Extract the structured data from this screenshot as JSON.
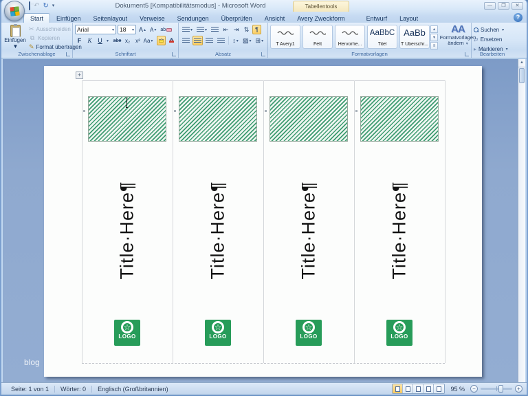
{
  "window": {
    "title": "Dokument5 [Kompatibilitätsmodus] - Microsoft Word",
    "contextual_tool_label": "Tabellentools",
    "help_label": "?"
  },
  "tabs": [
    {
      "label": "Start",
      "active": true
    },
    {
      "label": "Einfügen"
    },
    {
      "label": "Seitenlayout"
    },
    {
      "label": "Verweise"
    },
    {
      "label": "Sendungen"
    },
    {
      "label": "Überprüfen"
    },
    {
      "label": "Ansicht"
    },
    {
      "label": "Avery Zweckform"
    },
    {
      "label": "Entwurf",
      "contextual": true
    },
    {
      "label": "Layout",
      "contextual": true
    }
  ],
  "ribbon": {
    "clipboard": {
      "group_label": "Zwischenablage",
      "paste_label": "Einfügen",
      "cut_label": "Ausschneiden",
      "copy_label": "Kopieren",
      "format_painter_label": "Format übertragen"
    },
    "font": {
      "group_label": "Schriftart",
      "family": "Arial",
      "size": "18",
      "bold": "F",
      "italic": "K",
      "underline": "U",
      "strikethrough": "abe",
      "subscript": "x₂",
      "superscript": "x²",
      "change_case": "Aa"
    },
    "paragraph": {
      "group_label": "Absatz",
      "pilcrow": "¶"
    },
    "styles": {
      "group_label": "Formatvorlagen",
      "change_label": "Formatvorlagen ändern",
      "items": [
        {
          "label": "T Avery1",
          "preview": ""
        },
        {
          "label": "Fett",
          "preview": ""
        },
        {
          "label": "Hervorhe...",
          "preview": ""
        },
        {
          "label": "Titel",
          "preview": "AaBbC"
        },
        {
          "label": "T Überschr...",
          "preview": "AaBb"
        }
      ]
    },
    "editing": {
      "group_label": "Bearbeiten",
      "find_label": "Suchen",
      "replace_label": "Ersetzen",
      "select_label": "Markieren"
    }
  },
  "document": {
    "columns": [
      {
        "title": "Title·Here¶",
        "logo_text": "LOGO"
      },
      {
        "title": "Title·Here¶",
        "logo_text": "LOGO"
      },
      {
        "title": "Title·Here¶",
        "logo_text": "LOGO"
      },
      {
        "title": "Title·Here¶",
        "logo_text": "LOGO"
      }
    ]
  },
  "watermark": "blog",
  "status": {
    "page": "Seite: 1 von 1",
    "words": "Wörter: 0",
    "language": "Englisch (Großbritannien)",
    "zoom_level": "95 %"
  },
  "colors": {
    "logo_green": "#279c59",
    "hatch_green": "#3f9c72",
    "highlight_orange": "#f7c85f"
  }
}
